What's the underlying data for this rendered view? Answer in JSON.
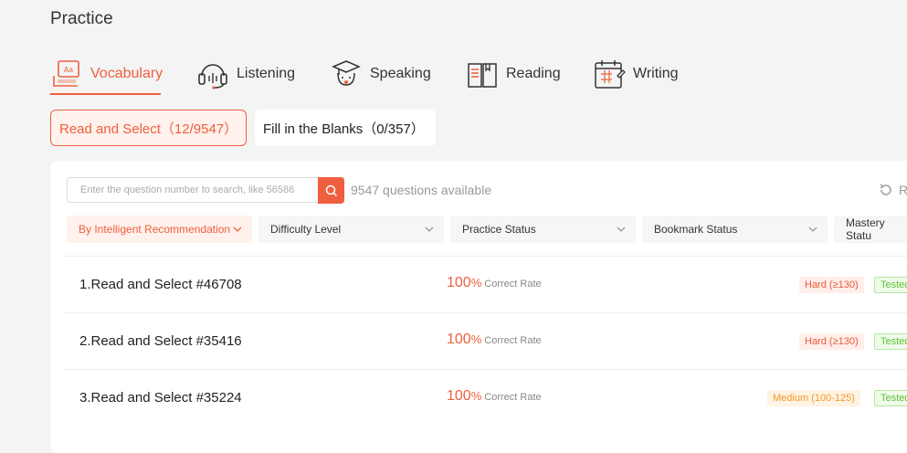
{
  "page": {
    "title": "Practice"
  },
  "tabs": [
    {
      "label": "Vocabulary",
      "icon": "vocabulary-icon"
    },
    {
      "label": "Listening",
      "icon": "headphones-icon"
    },
    {
      "label": "Speaking",
      "icon": "speaking-avatar-icon"
    },
    {
      "label": "Reading",
      "icon": "book-icon"
    },
    {
      "label": "Writing",
      "icon": "calendar-pen-icon"
    }
  ],
  "subtabs": [
    {
      "label": "Read and Select（12/9547）"
    },
    {
      "label": "Fill in the Blanks（0/357）"
    }
  ],
  "search": {
    "placeholder": "Enter the question number to search, like 56586"
  },
  "available": "9547 questions available",
  "reset_label": "R",
  "filters": [
    {
      "label": "By Intelligent Recommendation"
    },
    {
      "label": "Difficulty Level"
    },
    {
      "label": "Practice Status"
    },
    {
      "label": "Bookmark Status"
    },
    {
      "label": "Mastery Statu"
    }
  ],
  "questions": [
    {
      "title": "1.Read and Select #46708",
      "rate": "100",
      "rate_unit": "%",
      "rate_label": "Correct Rate",
      "difficulty": "Hard (≥130)",
      "status": "Tested"
    },
    {
      "title": "2.Read and Select #35416",
      "rate": "100",
      "rate_unit": "%",
      "rate_label": "Correct Rate",
      "difficulty": "Hard (≥130)",
      "status": "Tested"
    },
    {
      "title": "3.Read and Select #35224",
      "rate": "100",
      "rate_unit": "%",
      "rate_label": "Correct Rate",
      "difficulty": "Medium (100-125)",
      "status": "Tested"
    }
  ],
  "colors": {
    "accent": "#ef5f3f",
    "hard_bg": "#ffeeea",
    "medium_text": "#f09a2a",
    "tested_text": "#62c03a"
  }
}
